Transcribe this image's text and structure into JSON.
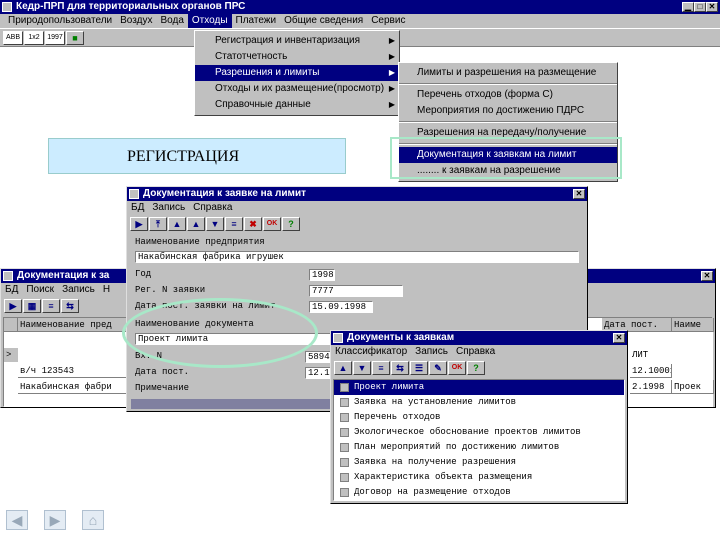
{
  "app": {
    "title": "Кедр-ПРП для территориальных органов ПРС",
    "menu": [
      "Природопользователи",
      "Воздух",
      "Вода",
      "Отходы",
      "Платежи",
      "Общие сведения",
      "Сервис"
    ],
    "toolbar_labels": [
      "ABB",
      "1x2",
      "1997"
    ]
  },
  "dropdown_main": {
    "items": [
      "Регистрация и инвентаризация",
      "Статотчетность",
      "Разрешения и лимиты",
      "Отходы и их размещение(просмотр)",
      "Справочные данные"
    ]
  },
  "dropdown_sub": {
    "items": [
      "Лимиты и разрешения на размещение",
      "Перечень отходов (форма С)",
      "Мероприятия по достижению ПДРС",
      "Разрешения на передачу/получение",
      "Документация к заявкам на лимит",
      "........ к заявкам на разрешение"
    ]
  },
  "banner": {
    "text": "РЕГИСТРАЦИЯ"
  },
  "doc_window": {
    "title": "Документация к заявке на лимит",
    "menu": [
      "БД",
      "Запись",
      "Справка"
    ],
    "fields": {
      "enterprise_label": "Наименование предприятия",
      "enterprise_value": "Накабинская фабрика игрушек",
      "year_label": "Год",
      "year_value": "1998",
      "reg_label": "Рег. N заявки",
      "reg_value": "7777",
      "date_label": "Дата пост. заявки на лимит",
      "date_value": "15.09.1998",
      "docname_label": "Наименование документа",
      "docname_value": "Проект лимита",
      "in_label": "Вх. N",
      "in_value": "5894",
      "date2_label": "Дата пост.",
      "date2_value": "12.1",
      "note_label": "Примечание"
    }
  },
  "back_window": {
    "title": "Документация к за",
    "menu": [
      "БД",
      "Поиск",
      "Запись",
      "Н"
    ],
    "col_name": "Наименование пред",
    "col_date": "Дата пост.",
    "col_date2": "ЛИТ",
    "col_name2": "Наиме",
    "row_marker": ">",
    "rows": [
      {
        "name": "в/ч 123543",
        "date": "12.10001",
        "name2": ""
      },
      {
        "name": "Накабинская фабри",
        "date": "2.1998",
        "name2": "Проек"
      }
    ]
  },
  "docs_window": {
    "title": "Документы к заявкам",
    "menu": [
      "Классификатор",
      "Запись",
      "Справка"
    ],
    "items": [
      "Проект лимита",
      "Заявка на установление лимитов",
      "Перечень отходов",
      "Экологическое обоснование проектов лимитов",
      "План мероприятий по достижению лимитов",
      "Заявка на получение разрешения",
      "Характеристика объекта размещения",
      "Договор на размещение отходов"
    ],
    "selected_index": 0
  }
}
